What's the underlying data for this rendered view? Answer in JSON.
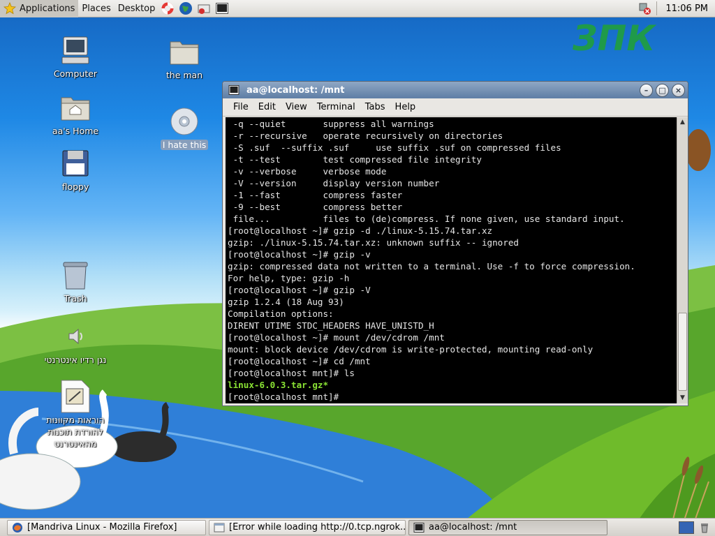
{
  "top_panel": {
    "menus": [
      {
        "label": "Applications"
      },
      {
        "label": "Places"
      },
      {
        "label": "Desktop"
      }
    ],
    "launchers": [
      "help-lifebuoy-icon",
      "web-browser-icon",
      "mail-icon",
      "terminal-icon"
    ],
    "clock": "11:06 PM"
  },
  "desktop": {
    "logo_text": "ЗПК",
    "icons": [
      {
        "name": "computer",
        "label": "Computer",
        "icon": "computer-icon"
      },
      {
        "name": "the-man",
        "label": "the man",
        "icon": "folder-icon"
      },
      {
        "name": "home",
        "label": "aa's Home",
        "icon": "home-folder-icon"
      },
      {
        "name": "i-hate-this",
        "label": "I hate this",
        "icon": "cdrom-icon"
      },
      {
        "name": "floppy",
        "label": "floppy",
        "icon": "floppy-icon"
      },
      {
        "name": "trash",
        "label": "Trash",
        "icon": "trash-icon"
      },
      {
        "name": "radio",
        "label": "נגן רדיו אינטרנטי",
        "icon": "speaker-icon"
      },
      {
        "name": "document",
        "label_lines": [
          "הוראות מקוונות",
          "להורדת תוכנות",
          "מהאינטרנט"
        ],
        "icon": "document-icon"
      }
    ]
  },
  "terminal": {
    "title": "aa@localhost: /mnt",
    "menu": [
      {
        "label": "File"
      },
      {
        "label": "Edit"
      },
      {
        "label": "View"
      },
      {
        "label": "Terminal"
      },
      {
        "label": "Tabs"
      },
      {
        "label": "Help"
      }
    ],
    "lines": [
      " -q --quiet       suppress all warnings",
      " -r --recursive   operate recursively on directories",
      " -S .suf  --suffix .suf     use suffix .suf on compressed files",
      " -t --test        test compressed file integrity",
      " -v --verbose     verbose mode",
      " -V --version     display version number",
      " -1 --fast        compress faster",
      " -9 --best        compress better",
      " file...          files to (de)compress. If none given, use standard input.",
      "[root@localhost ~]# gzip -d ./linux-5.15.74.tar.xz",
      "gzip: ./linux-5.15.74.tar.xz: unknown suffix -- ignored",
      "[root@localhost ~]# gzip -v",
      "gzip: compressed data not written to a terminal. Use -f to force compression.",
      "For help, type: gzip -h",
      "[root@localhost ~]# gzip -V",
      "gzip 1.2.4 (18 Aug 93)",
      "Compilation options:",
      "DIRENT UTIME STDC_HEADERS HAVE_UNISTD_H",
      "[root@localhost ~]# mount /dev/cdrom /mnt",
      "mount: block device /dev/cdrom is write-protected, mounting read-only",
      "[root@localhost ~]# cd /mnt",
      "[root@localhost mnt]# ls",
      "linux-6.0.3.tar.gz*",
      "[root@localhost mnt]#"
    ],
    "highlight_line_index": 22
  },
  "taskbar": {
    "tasks": [
      {
        "label": "[Mandriva Linux - Mozilla Firefox]",
        "icon": "firefox-icon",
        "active": false
      },
      {
        "label": "[Error while loading http://0.tcp.ngrok...",
        "icon": "browser-window-icon",
        "active": false
      },
      {
        "label": "aa@localhost: /mnt",
        "icon": "terminal-icon",
        "active": true
      }
    ]
  },
  "colors": {
    "terminal_bg": "#000000",
    "terminal_fg": "#e6e6e6",
    "executable_highlight": "#8ae234",
    "titlebar": "#5e7ea5"
  }
}
